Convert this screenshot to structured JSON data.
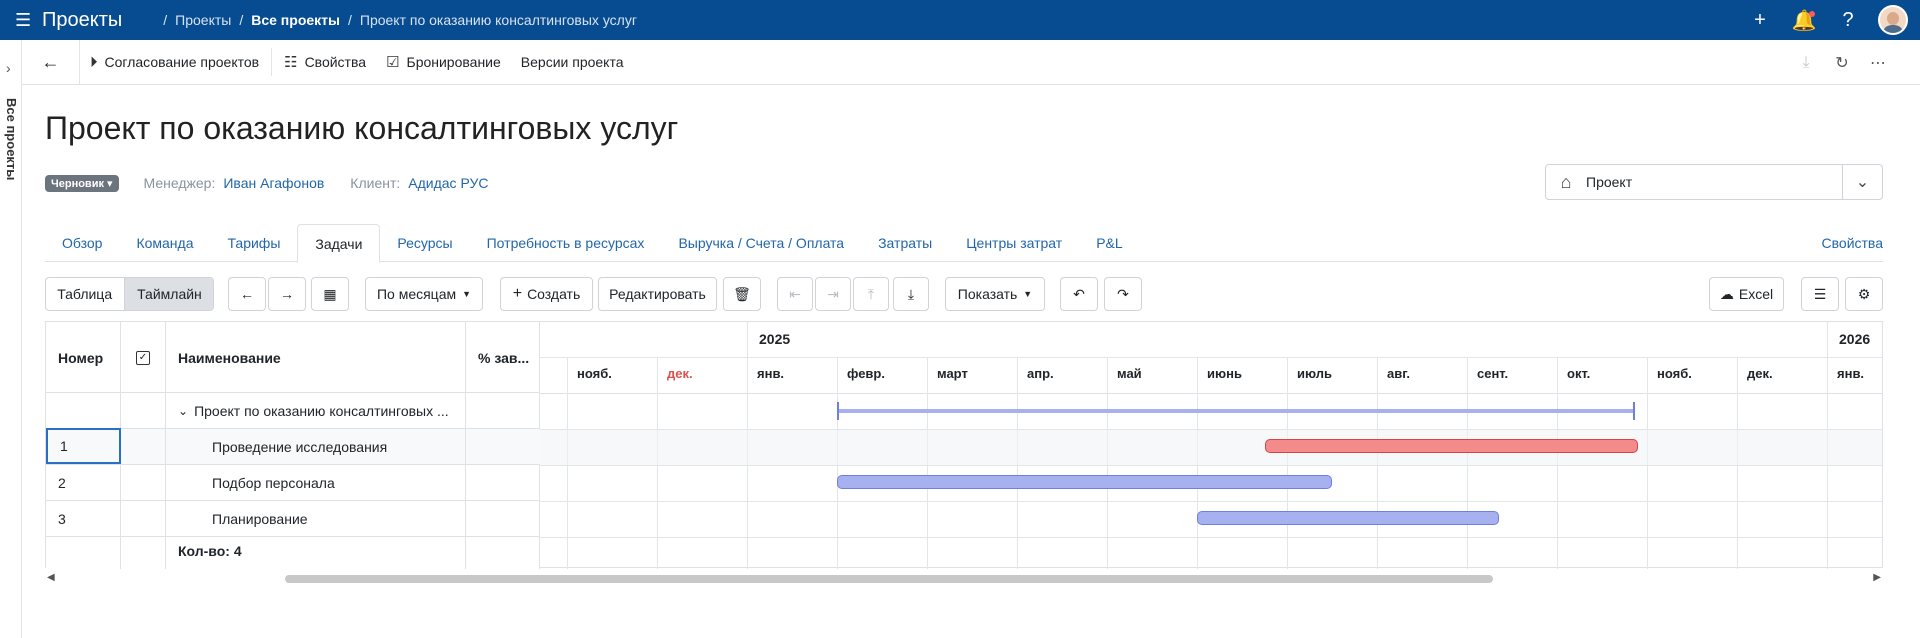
{
  "app": {
    "title": "Проекты"
  },
  "breadcrumbs": [
    "Проекты",
    "Все проекты",
    "Проект по оказанию консалтинговых услуг"
  ],
  "side_panel": {
    "label": "Все проекты"
  },
  "toolbar": {
    "approval": "Согласование проектов",
    "properties": "Свойства",
    "booking": "Бронирование",
    "versions": "Версии проекта"
  },
  "project": {
    "title": "Проект по оказанию консалтинговых услуг",
    "status": "Черновик",
    "manager_label": "Менеджер:",
    "manager": "Иван Агафонов",
    "client_label": "Клиент:",
    "client": "Адидас РУС",
    "type": "Проект"
  },
  "tabs": [
    "Обзор",
    "Команда",
    "Тарифы",
    "Задачи",
    "Ресурсы",
    "Потребность в ресурсах",
    "Выручка / Счета / Оплата",
    "Затраты",
    "Центры затрат",
    "P&L"
  ],
  "active_tab": "Задачи",
  "tabs_right": "Свойства",
  "grid_toolbar": {
    "view_table": "Таблица",
    "view_timeline": "Таймлайн",
    "scale": "По месяцам",
    "create": "Создать",
    "edit": "Редактировать",
    "show": "Показать",
    "excel": "Excel"
  },
  "columns": {
    "number": "Номер",
    "name": "Наименование",
    "percent": "% зав..."
  },
  "rows": [
    {
      "number": "",
      "name": "Проект по оказанию консалтинговых ..."
    },
    {
      "number": "1",
      "name": "Проведение исследования"
    },
    {
      "number": "2",
      "name": "Подбор персонала"
    },
    {
      "number": "3",
      "name": "Планирование"
    }
  ],
  "footer": {
    "count": "Кол-во: 4"
  },
  "timeline": {
    "years": [
      "2025",
      "2026"
    ],
    "months": [
      "нояб.",
      "дек.",
      "янв.",
      "февр.",
      "март",
      "апр.",
      "май",
      "июнь",
      "июль",
      "авг.",
      "сент.",
      "окт.",
      "нояб.",
      "дек.",
      "янв."
    ],
    "holiday_month_index": 1,
    "bar_colors": {
      "normal": "#a7b1f0",
      "overdue": "#f38b8b"
    },
    "bars": [
      {
        "row": 0,
        "type": "summary",
        "start_month": 3.0,
        "end_month": 11.87
      },
      {
        "row": 1,
        "type": "overdue",
        "start_month": 7.75,
        "end_month": 11.9
      },
      {
        "row": 2,
        "type": "normal",
        "start_month": 3.0,
        "end_month": 8.5
      },
      {
        "row": 3,
        "type": "normal",
        "start_month": 7.0,
        "end_month": 10.35
      }
    ]
  }
}
